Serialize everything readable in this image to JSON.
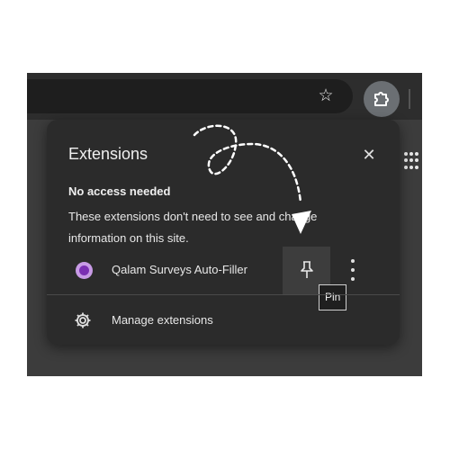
{
  "toolbar": {
    "bookmark_icon": "star-icon",
    "extensions_icon": "puzzle-icon",
    "apps_icon": "grid-dots-icon"
  },
  "popup": {
    "title": "Extensions",
    "close_icon": "close-icon",
    "section_heading": "No access needed",
    "section_description": "These extensions don't need to see and change information on this site.",
    "extensions": [
      {
        "name": "Qalam Surveys Auto-Filler",
        "pin_icon": "pin-icon",
        "more_icon": "more-vertical-icon",
        "tooltip": "Pin"
      }
    ],
    "manage": {
      "label": "Manage extensions",
      "icon": "gear-icon"
    }
  },
  "colors": {
    "popup_bg": "#2b2b2b",
    "toolbar_bg": "#2d2d2d",
    "text": "#e8e8e8",
    "ext_logo": "#7b2fb3"
  }
}
